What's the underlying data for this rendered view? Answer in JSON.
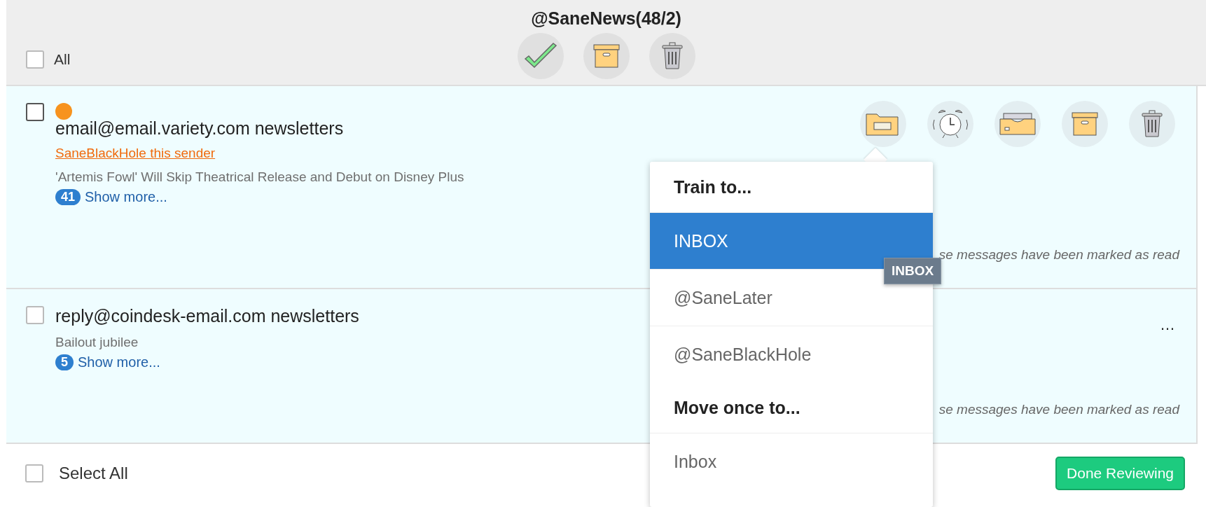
{
  "header": {
    "title": "@SaneNews(48/2)",
    "select_all": {
      "label": "All",
      "checked": false
    }
  },
  "senders": [
    {
      "sender": "email@email.variety.com newsletters",
      "checked": false,
      "new": true,
      "block_link": "SaneBlackHole this sender",
      "subject": "'Artemis Fowl' Will Skip Theatrical Release and Debut on Disney Plus",
      "count": "41",
      "show_more": "Show more...",
      "note": "se messages have been marked as read",
      "actions_open": true
    },
    {
      "sender": "reply@coindesk-email.com newsletters",
      "checked": false,
      "new": false,
      "subject": "Bailout jubilee",
      "count": "5",
      "show_more": "Show more...",
      "note": "se messages have been marked as read",
      "actions_open": false,
      "more_label": "…"
    }
  ],
  "menu": {
    "sections": [
      {
        "heading": "Train to...",
        "items": [
          {
            "label": "INBOX",
            "selected": true
          },
          {
            "label": "@SaneLater",
            "selected": false
          },
          {
            "label": "@SaneBlackHole",
            "selected": false
          }
        ]
      },
      {
        "heading": "Move once to...",
        "items": [
          {
            "label": "Inbox",
            "selected": false
          }
        ]
      }
    ]
  },
  "tooltip": "INBOX",
  "footer": {
    "select_all": {
      "label": "Select All",
      "checked": false
    },
    "done_button": "Done Reviewing"
  }
}
